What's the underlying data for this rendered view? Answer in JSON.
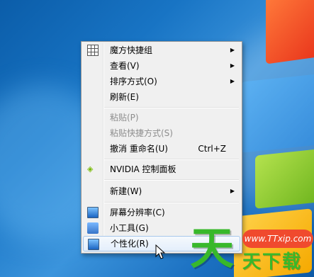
{
  "context_menu": {
    "items": [
      {
        "label": "魔方快捷组",
        "shortcut": "",
        "submenu": true,
        "disabled": false,
        "icon": "grid-icon"
      },
      {
        "label": "查看(V)",
        "shortcut": "",
        "submenu": true,
        "disabled": false,
        "icon": ""
      },
      {
        "label": "排序方式(O)",
        "shortcut": "",
        "submenu": true,
        "disabled": false,
        "icon": ""
      },
      {
        "label": "刷新(E)",
        "shortcut": "",
        "submenu": false,
        "disabled": false,
        "icon": ""
      },
      {
        "label": "粘贴(P)",
        "shortcut": "",
        "submenu": false,
        "disabled": true,
        "icon": ""
      },
      {
        "label": "粘贴快捷方式(S)",
        "shortcut": "",
        "submenu": false,
        "disabled": true,
        "icon": ""
      },
      {
        "label": "撤消 重命名(U)",
        "shortcut": "Ctrl+Z",
        "submenu": false,
        "disabled": false,
        "icon": ""
      },
      {
        "label": "NVIDIA 控制面板",
        "shortcut": "",
        "submenu": false,
        "disabled": false,
        "icon": "nvidia-icon"
      },
      {
        "label": "新建(W)",
        "shortcut": "",
        "submenu": true,
        "disabled": false,
        "icon": ""
      },
      {
        "label": "屏幕分辨率(C)",
        "shortcut": "",
        "submenu": false,
        "disabled": false,
        "icon": "monitor-icon"
      },
      {
        "label": "小工具(G)",
        "shortcut": "",
        "submenu": false,
        "disabled": false,
        "icon": "gadget-icon"
      },
      {
        "label": "个性化(R)",
        "shortcut": "",
        "submenu": false,
        "disabled": false,
        "icon": "personalize-icon",
        "hover": true
      }
    ],
    "submenu_arrow": "▶"
  },
  "watermark": {
    "logo_char": "天",
    "url": "www.TTxip.com",
    "name": "天下载"
  },
  "colors": {
    "desktop_blue": "#1874c4",
    "menu_bg": "#f0f0f0",
    "hover_border": "#a8c8eb",
    "disabled_text": "#8d8d8d",
    "watermark_green": "#38b82b",
    "watermark_red": "#f04a2e"
  }
}
